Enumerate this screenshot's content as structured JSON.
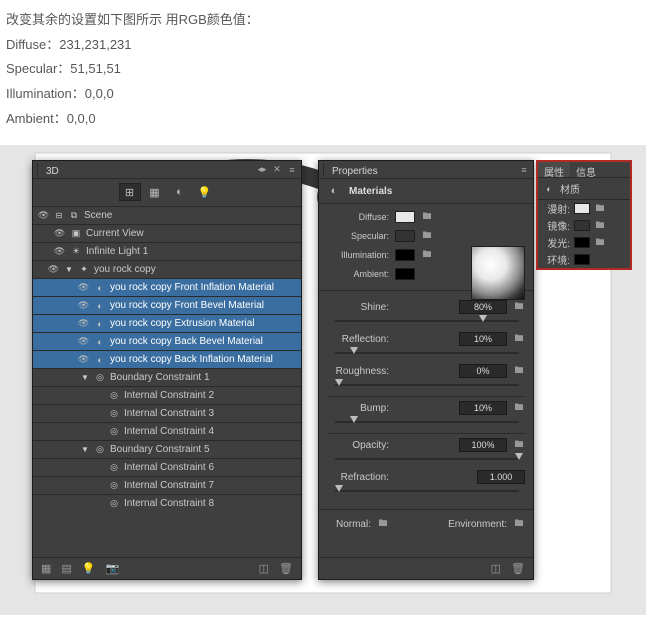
{
  "instructions": {
    "line1": "改变其余的设置如下图所示   用RGB颜色值：",
    "diffuse": "Diffuse：231,231,231",
    "specular": "Specular：51,51,51",
    "illumination": "Illumination：0,0,0",
    "ambient": "Ambient：0,0,0"
  },
  "panel3d": {
    "title": "3D",
    "scene": "Scene",
    "currentView": "Current View",
    "infiniteLight": "Infinite Light 1",
    "youRock": "you rock copy",
    "mats": [
      "you rock copy Front Inflation Material",
      "you rock copy Front Bevel Material",
      "you rock copy Extrusion Material",
      "you rock copy Back Bevel Material",
      "you rock copy Back Inflation Material"
    ],
    "bc1": "Boundary Constraint 1",
    "ic2": "Internal Constraint 2",
    "ic3": "Internal Constraint 3",
    "ic4": "Internal Constraint 4",
    "bc5": "Boundary Constraint 5",
    "ic6": "Internal Constraint 6",
    "ic7": "Internal Constraint 7",
    "ic8": "Internal Constraint 8"
  },
  "props": {
    "title": "Properties",
    "materials": "Materials",
    "diffuse": "Diffuse:",
    "specular": "Specular:",
    "illumination": "Illumination:",
    "ambient": "Ambient:",
    "shine": "Shine:",
    "shineV": "80%",
    "reflection": "Reflection:",
    "reflectionV": "10%",
    "roughness": "Roughness:",
    "roughnessV": "0%",
    "bump": "Bump:",
    "bumpV": "10%",
    "opacity": "Opacity:",
    "opacityV": "100%",
    "refraction": "Refraction:",
    "refractionV": "1.000",
    "normal": "Normal:",
    "environment": "Environment:"
  },
  "cn": {
    "tabAttr": "属性",
    "tabInfo": "信息",
    "material": "材质",
    "diffuse": "漫射:",
    "specular": "镜像:",
    "glow": "发光:",
    "ambient": "环境:"
  },
  "colors": {
    "diffuse": "#e7e7e7",
    "specular": "#333333",
    "black": "#000000"
  }
}
